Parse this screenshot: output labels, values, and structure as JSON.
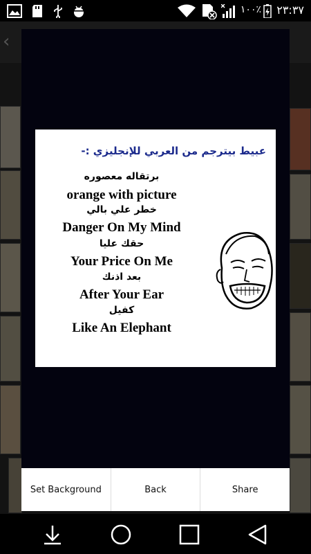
{
  "status_bar": {
    "time": "٢٣:٣٧",
    "battery_percent": "١٠٠٪",
    "icons": [
      "gallery-icon",
      "sd-card-icon",
      "usb-icon",
      "android-debug-icon",
      "wifi-icon",
      "sim-off-icon",
      "signal-icon",
      "battery-icon"
    ]
  },
  "dialog": {
    "image": {
      "title": "عبيط بيترجم من العربي للإنجليزي :-",
      "lines": [
        {
          "text": "برتقاله معصوره",
          "lang": "ar"
        },
        {
          "text": "orange with picture",
          "lang": "en"
        },
        {
          "text": "خطر علي بالي",
          "lang": "ar"
        },
        {
          "text": "Danger On My Mind",
          "lang": "en"
        },
        {
          "text": "حقك عليا",
          "lang": "ar"
        },
        {
          "text": "Your Price On Me",
          "lang": "en"
        },
        {
          "text": "بعد اذنك",
          "lang": "ar"
        },
        {
          "text": "After Your Ear",
          "lang": "en"
        },
        {
          "text": "كفيل",
          "lang": "ar"
        },
        {
          "text": "Like An Elephant",
          "lang": "en"
        }
      ]
    },
    "buttons": {
      "set_background": "Set Background",
      "back": "Back",
      "share": "Share"
    }
  },
  "nav_bar": {
    "icons": [
      "download-icon",
      "home-icon",
      "recents-icon",
      "back-icon"
    ]
  }
}
